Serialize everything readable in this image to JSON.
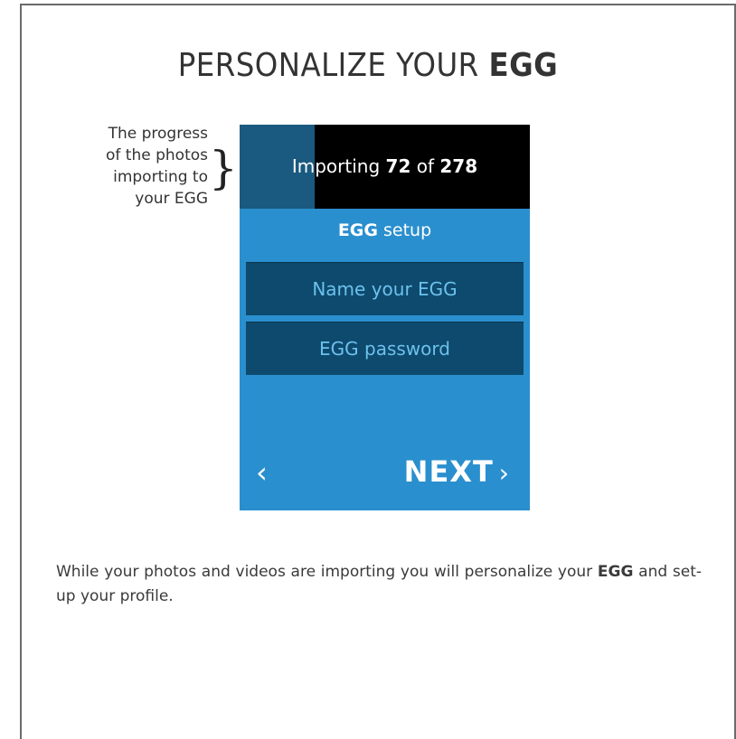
{
  "title": {
    "prefix": "PERSONALIZE YOUR ",
    "bold": "EGG"
  },
  "annotation": {
    "lines": [
      "The progress",
      "of the photos",
      "importing to",
      "your EGG"
    ]
  },
  "phone": {
    "progress": {
      "label_prefix": "Importing ",
      "current": "72",
      "label_mid": " of ",
      "total": "278",
      "fraction": 0.259
    },
    "setup_title": {
      "bold": "EGG",
      "rest": " setup"
    },
    "fields": {
      "name_placeholder": "Name your EGG",
      "password_placeholder": "EGG password"
    },
    "nav": {
      "back": "‹",
      "next": "NEXT",
      "next_arrow": "›"
    }
  },
  "description": {
    "part1": "While your photos and videos are importing you will personalize your ",
    "bold": "EGG",
    "part2": " and set-up your profile."
  },
  "colors": {
    "accent": "#2a8fce",
    "field_bg": "#0d4a6e",
    "field_text": "#6dc1ec"
  }
}
